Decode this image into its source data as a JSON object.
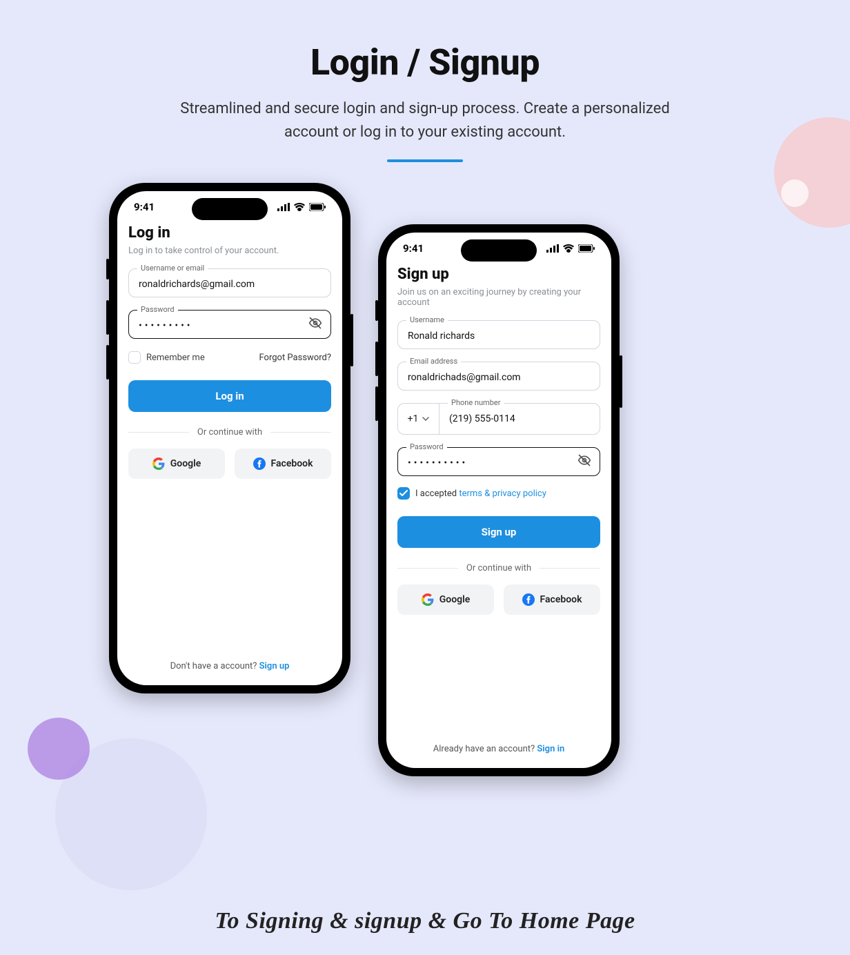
{
  "header": {
    "title": "Login / Signup",
    "subtitle": "Streamlined and secure login and sign-up process. Create a personalized account or log in to your existing account."
  },
  "status": {
    "time": "9:41"
  },
  "login": {
    "title": "Log in",
    "subtitle": "Log in to take control of your account.",
    "username_label": "Username or email",
    "username_value": "ronaldrichards@gmail.com",
    "password_label": "Password",
    "password_value": "•••••••••",
    "remember": "Remember me",
    "forgot": "Forgot Password?",
    "submit": "Log in",
    "divider": "Or continue with",
    "google": "Google",
    "facebook": "Facebook",
    "bottom_text": "Don't have a account? ",
    "bottom_link": "Sign up"
  },
  "signup": {
    "title": "Sign up",
    "subtitle": "Join us on an exciting journey by creating your account",
    "username_label": "Username",
    "username_value": "Ronald richards",
    "email_label": "Email address",
    "email_value": "ronaldrichads@gmail.com",
    "phone_label": "Phone number",
    "phone_code": "+1",
    "phone_value": "(219) 555-0114",
    "password_label": "Password",
    "password_value": "••••••••••",
    "terms_text": "I accepted ",
    "terms_link": "terms & privacy policy",
    "submit": "Sign up",
    "divider": "Or continue with",
    "google": "Google",
    "facebook": "Facebook",
    "bottom_text": "Already have an account? ",
    "bottom_link": "Sign in"
  },
  "tagline": "To Signing & signup & Go To Home Page"
}
